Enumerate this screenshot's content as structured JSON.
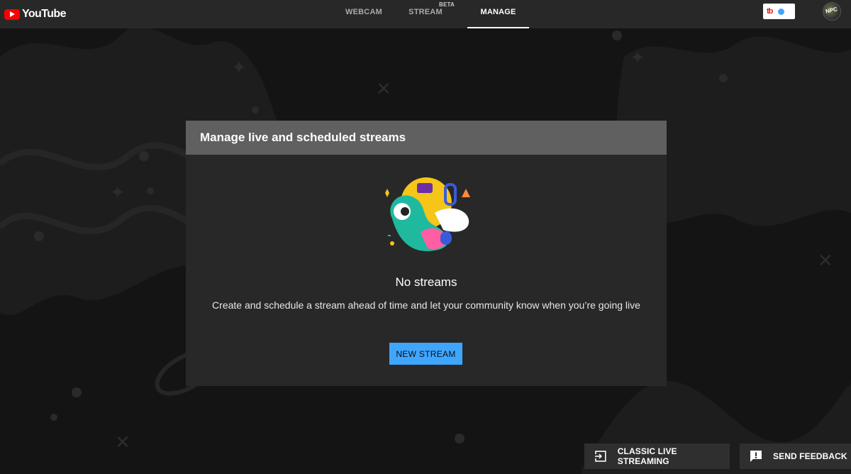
{
  "header": {
    "logo_text": "YouTube",
    "tabs": [
      {
        "label": "WEBCAM",
        "active": false
      },
      {
        "label": "STREAM",
        "badge": "BETA",
        "active": false
      },
      {
        "label": "MANAGE",
        "active": true
      }
    ],
    "extension_logo": "tb",
    "avatar_text": "NPC"
  },
  "dialog": {
    "title": "Manage live and scheduled streams",
    "empty_title": "No streams",
    "empty_subtitle": "Create and schedule a stream ahead of time and let your community know when you’re going live",
    "new_stream_label": "NEW STREAM"
  },
  "footer": {
    "classic_label": "CLASSIC LIVE STREAMING",
    "feedback_label": "SEND FEEDBACK"
  },
  "colors": {
    "accent": "#3ea6ff",
    "brand_red": "#ff0000",
    "header_bg": "#282828",
    "dialog_header": "#606060"
  },
  "icons": [
    "youtube-logo-icon",
    "exit-to-app-icon",
    "feedback-icon"
  ]
}
